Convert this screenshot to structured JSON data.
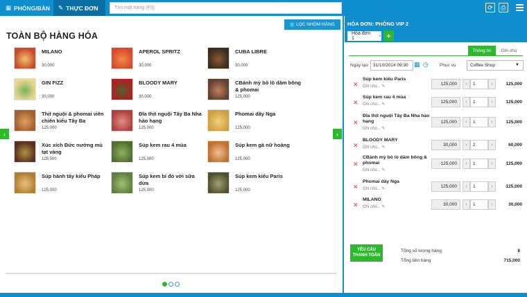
{
  "app": {
    "tab_rooms": "PHÒNG/BÀN",
    "tab_menu": "THỰC ĐƠN",
    "search_placeholder": "Tìm mặt hàng (F3)"
  },
  "products": {
    "filter_label": "LỌC NHÓM HÀNG",
    "title": "TOÀN BỘ HÀNG HÓA",
    "items": [
      {
        "name": "MILANO",
        "price": "30,000"
      },
      {
        "name": "APEROL SPRITZ",
        "price": "30,000"
      },
      {
        "name": "CUBA LIBRE",
        "price": "30,000"
      },
      {
        "name": "GIN FIZZ",
        "price": "30,000"
      },
      {
        "name": "BLOODY MARY",
        "price": "30,000"
      },
      {
        "name": "CBánh mỳ bò lò dăm bông & phomai",
        "price": "125,000"
      },
      {
        "name": "Thịt nguội & phomai viên chiên kiểu Tây Ba",
        "price": "125,000"
      },
      {
        "name": "Đĩa thịt nguội Tây Ba Nha hảo hạng",
        "price": "125,000"
      },
      {
        "name": "Phomai dây Nga",
        "price": "125,000"
      },
      {
        "name": "Xúc xích Đức nướng mù tạt vàng",
        "price": "125,000"
      },
      {
        "name": "Súp kem rau 4 mùa",
        "price": "125,000"
      },
      {
        "name": "Súp kem gà nữ hoàng",
        "price": "125,000"
      },
      {
        "name": "Súp hành tây kiểu Pháp",
        "price": "125,000"
      },
      {
        "name": "Súp kem bí đỏ với sữa dừa",
        "price": "125,000"
      },
      {
        "name": "Súp kem kiểu Paris",
        "price": "125,000"
      }
    ]
  },
  "invoice": {
    "header": "HÓA ĐƠN: PHÒNG VIP 2",
    "tab_label": "Hóa đơn 1",
    "info_tab": "Thông tin",
    "note_tab": "Ghi chú",
    "date_label": "Ngày tạo",
    "date_value": "31/10/2014 09:30",
    "serve_label": "Phục vụ",
    "serve_value": "Coffee Shop",
    "note_placeholder": "Ghi chú...",
    "lines": [
      {
        "name": "Súp kem kiểu Paris",
        "price": "125,000",
        "qty": "1",
        "total": "125,000"
      },
      {
        "name": "Súp kem rau 4 mùa",
        "price": "125,000",
        "qty": "1",
        "total": "125,000"
      },
      {
        "name": "Đĩa thịt nguội Tây Ba Nha hảo hạng",
        "price": "125,000",
        "qty": "1",
        "total": "125,000"
      },
      {
        "name": "BLOODY MARY",
        "price": "30,000",
        "qty": "2",
        "total": "60,000"
      },
      {
        "name": "CBánh mỳ bò lò dăm bông & phomai",
        "price": "125,000",
        "qty": "1",
        "total": "125,000"
      },
      {
        "name": "Phomai dây Nga",
        "price": "125,000",
        "qty": "1",
        "total": "125,000"
      },
      {
        "name": "MILANO",
        "price": "30,000",
        "qty": "1",
        "total": "30,000"
      }
    ],
    "pay_button": "YÊU CẦU THANH TOÁN",
    "total_qty_label": "Tổng số lượng hàng",
    "total_qty": "8",
    "total_amount_label": "Tổng tiền hàng",
    "total_amount": "715,000"
  }
}
